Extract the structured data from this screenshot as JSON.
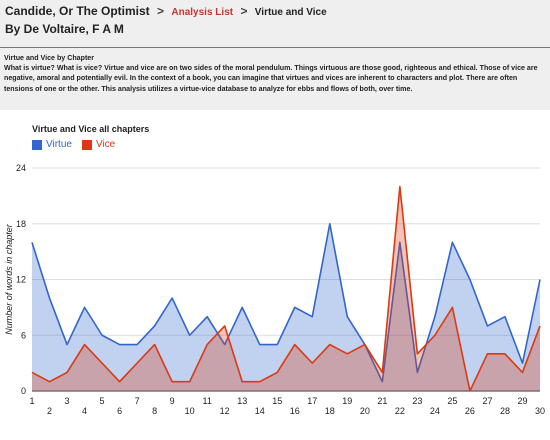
{
  "header": {
    "book_title": "Candide, Or The Optimist",
    "separator": ">",
    "analysis_link": "Analysis List",
    "current_page": "Virtue and Vice",
    "author": "By De Voltaire, F A M"
  },
  "description": {
    "heading": "Virtue and Vice by Chapter",
    "body": "What is virtue? What is vice? Virtue and vice are on two sides of the moral pendulum. Things virtuous are those good, righteous and ethical. Those of vice are negative, amoral and potentially evil. In the context of a book, you can imagine that virtues and vices are inherent to characters and plot. There are often tensions of one or the other. This analysis utilizes a virtue-vice database to analyze for ebbs and flows of both, over time."
  },
  "colors": {
    "virtue": "#3366cc",
    "vice": "#dc3912"
  },
  "chart_data": {
    "type": "area",
    "title": "Virtue and Vice all chapters",
    "xlabel": "",
    "ylabel": "Number of words in chapter",
    "x": [
      1,
      2,
      3,
      4,
      5,
      6,
      7,
      8,
      9,
      10,
      11,
      12,
      13,
      14,
      15,
      16,
      17,
      18,
      19,
      20,
      21,
      22,
      23,
      24,
      25,
      26,
      27,
      28,
      29,
      30
    ],
    "xticks_bottom": [
      "1",
      "3",
      "5",
      "7",
      "9",
      "11",
      "13",
      "15",
      "17",
      "19",
      "21",
      "23",
      "25",
      "27",
      "29"
    ],
    "xticks_top": [
      "2",
      "4",
      "6",
      "8",
      "10",
      "12",
      "14",
      "16",
      "18",
      "20",
      "22",
      "24",
      "26",
      "28",
      "30"
    ],
    "yticks": [
      "0",
      "6",
      "12",
      "18",
      "24"
    ],
    "ylim": [
      0,
      24
    ],
    "grid": true,
    "legend_position": "top-left",
    "series": [
      {
        "name": "Virtue",
        "values": [
          16,
          10,
          5,
          9,
          6,
          5,
          5,
          7,
          10,
          6,
          8,
          5,
          9,
          5,
          5,
          9,
          8,
          18,
          8,
          5,
          1,
          16,
          2,
          8,
          16,
          12,
          7,
          8,
          3,
          12
        ]
      },
      {
        "name": "Vice",
        "values": [
          2,
          1,
          2,
          5,
          3,
          1,
          3,
          5,
          1,
          1,
          5,
          7,
          1,
          1,
          2,
          5,
          3,
          5,
          4,
          5,
          2,
          22,
          4,
          6,
          9,
          0,
          4,
          4,
          2,
          7
        ]
      }
    ]
  }
}
